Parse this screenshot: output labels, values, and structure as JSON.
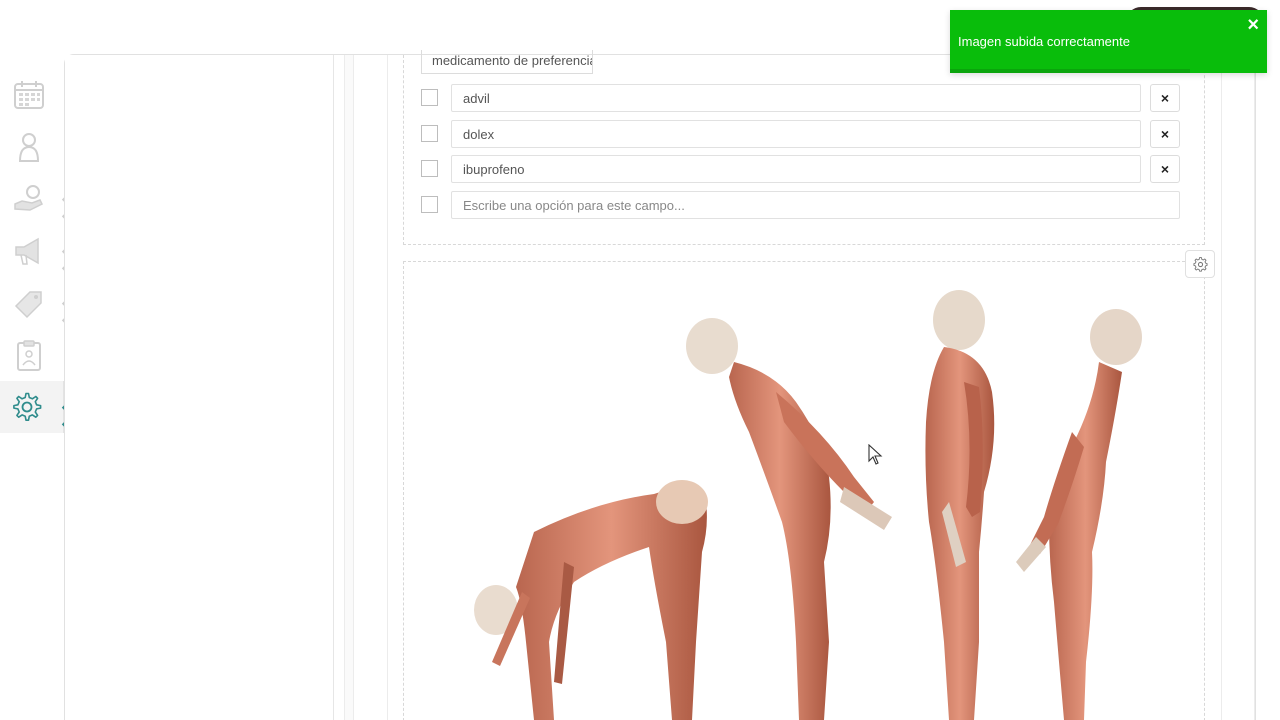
{
  "toast": {
    "message": "Imagen subida correctamente",
    "close_glyph": "×",
    "color": "#09bd0b"
  },
  "sidebar": {
    "items": [
      {
        "icon": "calendar-icon",
        "has_submenu": false
      },
      {
        "icon": "user-icon",
        "has_submenu": false
      },
      {
        "icon": "money-hand-icon",
        "has_submenu": true
      },
      {
        "icon": "megaphone-icon",
        "has_submenu": true
      },
      {
        "icon": "tag-icon",
        "has_submenu": true
      },
      {
        "icon": "clipboard-icon",
        "has_submenu": false
      },
      {
        "icon": "gear-icon",
        "has_submenu": true,
        "active": true
      }
    ],
    "accent_color": "#2f8c8c"
  },
  "form": {
    "field_label": "medicamento de preferencia",
    "options": [
      {
        "value": "advil",
        "delete_label": "×"
      },
      {
        "value": "dolex",
        "delete_label": "×"
      },
      {
        "value": "ibuprofeno",
        "delete_label": "×"
      }
    ],
    "new_option_placeholder": "Escribe una opción para este campo..."
  },
  "image_block": {
    "image": "anatomy-forward-bend-poses",
    "settings_icon": "gear-icon"
  }
}
